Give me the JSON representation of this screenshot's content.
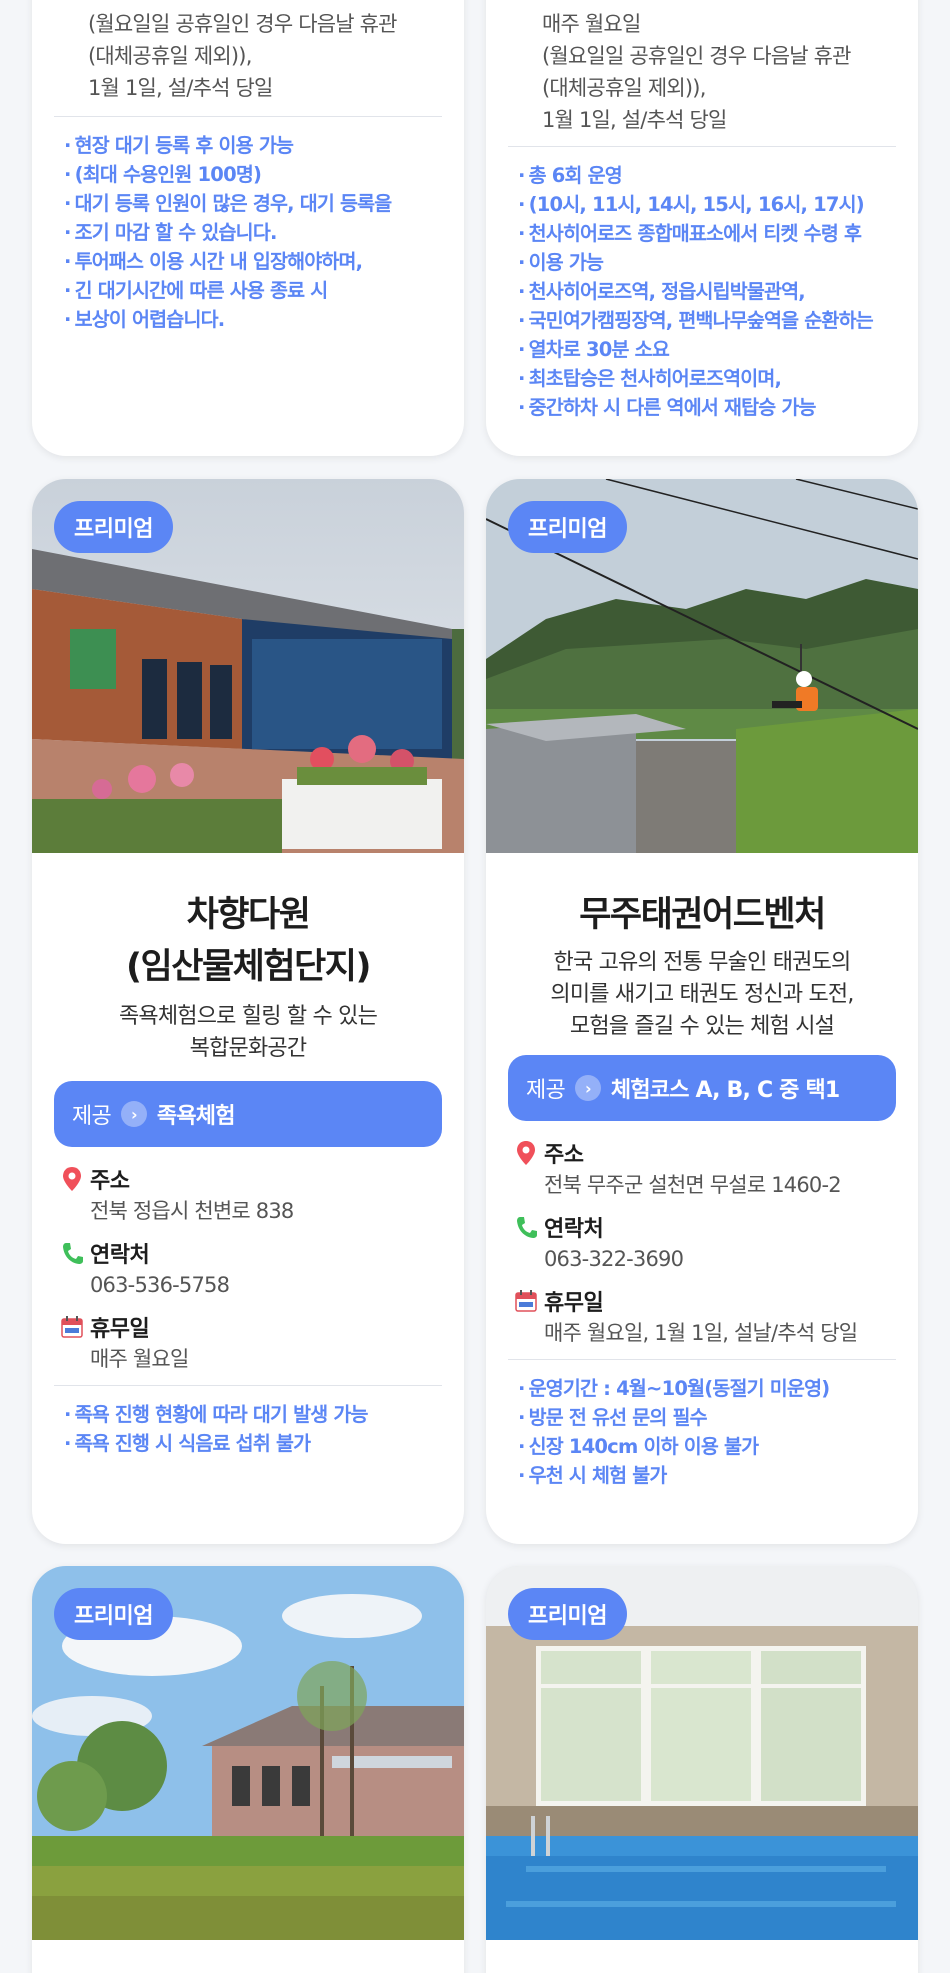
{
  "colors": {
    "accent": "#5b86f5",
    "page_bg": "#f4f6f9",
    "card_bg": "#ffffff"
  },
  "top_left": {
    "closed_lines": [
      "(월요일일 공휴일인 경우 다음날 휴관",
      "(대체공휴일 제외)),",
      "1월 1일, 설/추석 당일"
    ],
    "notes": [
      "현장 대기 등록 후 이용 가능",
      "(최대 수용인원 100명)",
      "대기 등록 인원이 많은 경우, 대기 등록을",
      "조기 마감 할 수 있습니다.",
      "투어패스 이용 시간 내 입장해야하며,",
      "긴 대기시간에 따른 사용 종료 시",
      "보상이 어렵습니다."
    ]
  },
  "top_right": {
    "closed_lines": [
      "매주 월요일",
      "(월요일일 공휴일인 경우 다음날 휴관",
      "(대체공휴일 제외)),",
      "1월 1일, 설/추석 당일"
    ],
    "notes": [
      "총 6회 운영",
      "(10시, 11시, 14시, 15시, 16시, 17시)",
      "천사히어로즈 종합매표소에서 티켓 수령 후",
      "이용 가능",
      "천사히어로즈역, 정읍시립박물관역,",
      "국민여가캠핑장역, 편백나무숲역을 순환하는",
      "열차로 30분 소요",
      "최초탑승은 천사히어로즈역이며,",
      "중간하차 시 다른 역에서 재탑승 가능"
    ]
  },
  "mid_left": {
    "badge": "프리미엄",
    "title_line1": "차향다원",
    "title_line2": "(임산물체험단지)",
    "desc_line1": "족욕체험으로 힐링 할 수 있는",
    "desc_line2": "복합문화공간",
    "offer_label": "제공",
    "offer_value": "족욕체험",
    "address_label": "주소",
    "address": "전북 정읍시 천변로 838",
    "phone_label": "연락처",
    "phone": "063-536-5758",
    "closed_label": "휴무일",
    "closed": "매주 월요일",
    "notes": [
      "족욕 진행 현황에 따라 대기 발생 가능",
      "족욕 진행 시 식음료 섭취 불가"
    ]
  },
  "mid_right": {
    "badge": "프리미엄",
    "title": "무주태권어드벤처",
    "desc_line1": "한국 고유의 전통 무술인 태권도의",
    "desc_line2": "의미를 새기고 태권도 정신과 도전,",
    "desc_line3": "모험을 즐길 수 있는 체험 시설",
    "offer_label": "제공",
    "offer_value": "체험코스 A, B, C 중 택1",
    "address_label": "주소",
    "address": "전북 무주군 설천면 무설로 1460-2",
    "phone_label": "연락처",
    "phone": "063-322-3690",
    "closed_label": "휴무일",
    "closed": "매주 월요일, 1월 1일, 설날/추석 당일",
    "notes": [
      "운영기간 : 4월~10월(동절기 미운영)",
      "방문 전 유선 문의 필수",
      "신장 140cm 이하 이용 불가",
      "우천 시 체험 불가"
    ]
  },
  "bot_left": {
    "badge": "프리미엄"
  },
  "bot_right": {
    "badge": "프리미엄"
  }
}
